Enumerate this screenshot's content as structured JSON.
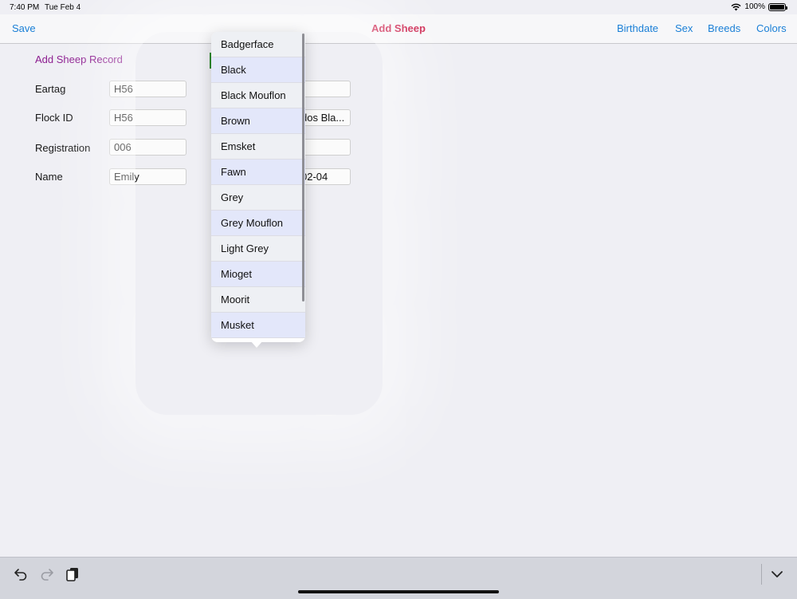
{
  "status_bar": {
    "time": "7:40 PM",
    "date": "Tue Feb 4",
    "battery": "100%"
  },
  "nav": {
    "title": "Add Sheep",
    "save_label": "Save",
    "right_buttons": [
      "Birthdate",
      "Sex",
      "Breeds",
      "Colors"
    ]
  },
  "form": {
    "title": "Add Sheep Record",
    "fields": [
      {
        "label": "Eartag",
        "value": "H56"
      },
      {
        "label": "Flock ID",
        "value": "H56"
      },
      {
        "label": "Registration",
        "value": "006"
      },
      {
        "label": "Name",
        "value": "Emily"
      }
    ],
    "right_fields": [
      {
        "value": ""
      },
      {
        "value": "dos Bla..."
      },
      {
        "value": ""
      },
      {
        "value": "02-04"
      }
    ]
  },
  "color_picker": {
    "options": [
      "Badgerface",
      "Black",
      "Black Mouflon",
      "Brown",
      "Emsket",
      "Fawn",
      "Grey",
      "Grey Mouflon",
      "Light Grey",
      "Mioget",
      "Moorit",
      "Musket"
    ]
  },
  "toolbar": {
    "icons": [
      "undo-icon",
      "redo-icon",
      "clipboard-icon",
      "chevron-down-icon"
    ]
  },
  "colors": {
    "accent": "#1a7fd6",
    "title": "#cc1e4a",
    "form_title": "#8b1a8e"
  }
}
